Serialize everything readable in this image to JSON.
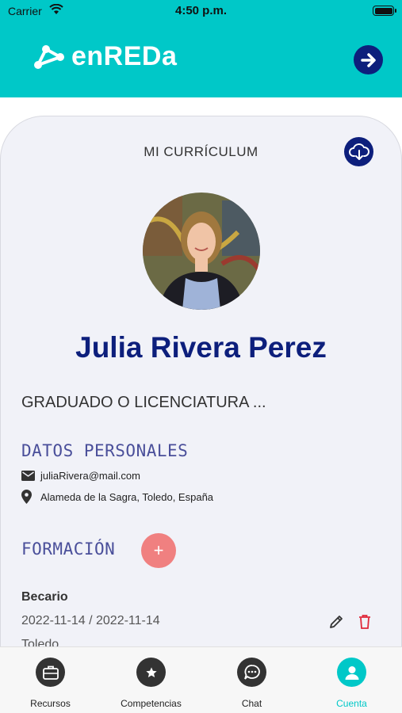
{
  "status_bar": {
    "carrier": "Carrier",
    "time": "4:50 p.m."
  },
  "header": {
    "logo_text": "enREDa",
    "logout_icon": "arrow-right-circle-icon"
  },
  "card": {
    "title": "MI CURRÍCULUM",
    "download_icon": "cloud-download-icon",
    "name": "Julia Rivera Perez",
    "degree": "GRADUADO O LICENCIATURA ...",
    "personal_section": {
      "title": "DATOS PERSONALES",
      "email": "juliaRivera@mail.com",
      "location": "Alameda de la Sagra, Toledo, España"
    },
    "education_section": {
      "title": "FORMACIÓN",
      "add_label": "+",
      "items": [
        {
          "title": "Becario",
          "dates": "2022-11-14 / 2022-11-14",
          "place": "Toledo"
        }
      ]
    }
  },
  "tabbar": {
    "tabs": [
      {
        "label": "Recursos",
        "icon": "briefcase-icon"
      },
      {
        "label": "Competencias",
        "icon": "star-icon"
      },
      {
        "label": "Chat",
        "icon": "chat-icon"
      },
      {
        "label": "Cuenta",
        "icon": "user-icon",
        "active": true
      }
    ]
  },
  "colors": {
    "primary": "#00c8c8",
    "navy": "#0d1f7c",
    "accent": "#f08080",
    "section": "#4a4f9a"
  }
}
